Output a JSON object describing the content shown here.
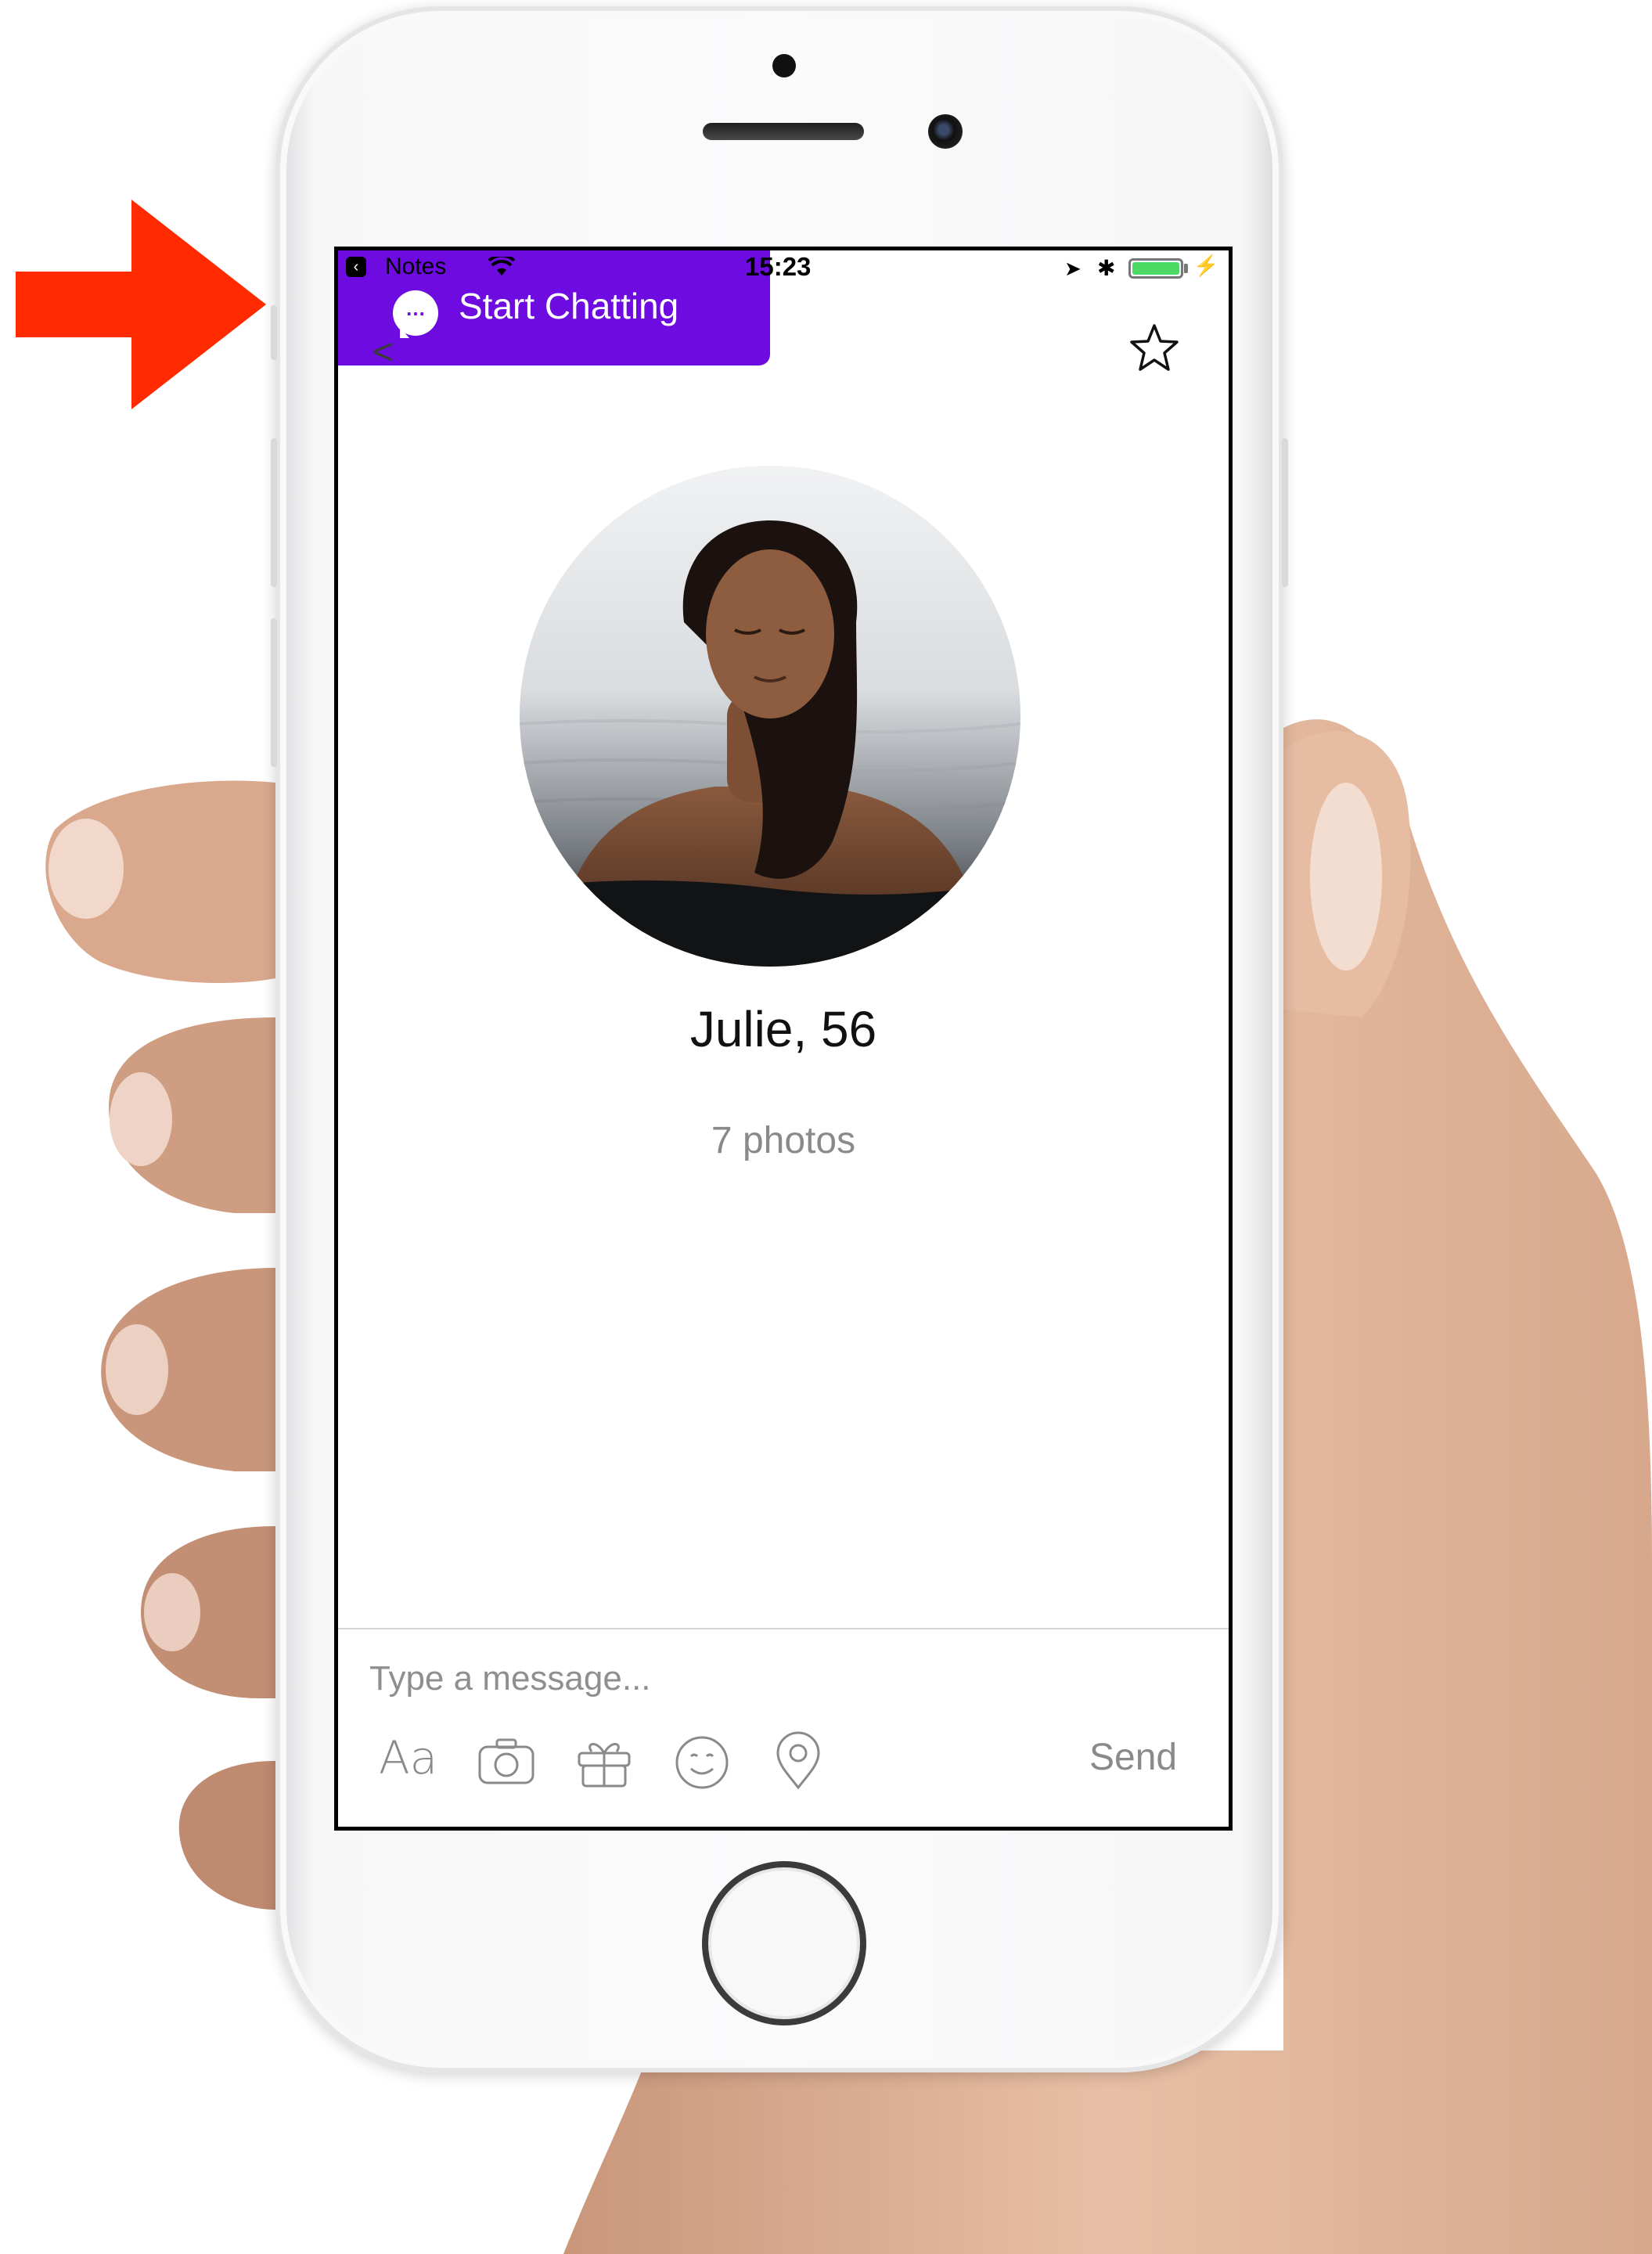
{
  "status_bar": {
    "back_app": "Notes",
    "time": "15:23"
  },
  "banner": {
    "label": "Start Chatting",
    "bubble_glyph": "…",
    "color": "#6d0be0"
  },
  "navigation": {
    "back_glyph": "<",
    "favorite_icon": "star-icon"
  },
  "profile": {
    "name": "Julie, 56",
    "photos": "7 photos"
  },
  "composer": {
    "placeholder": "Type a message...",
    "font_label": "Aa",
    "tools": [
      "font-icon",
      "camera-icon",
      "gift-icon",
      "emoji-icon",
      "location-pin-icon"
    ],
    "send_label": "Send"
  },
  "colors": {
    "annotation_arrow": "#ff2a00",
    "battery": "#4cd964"
  }
}
